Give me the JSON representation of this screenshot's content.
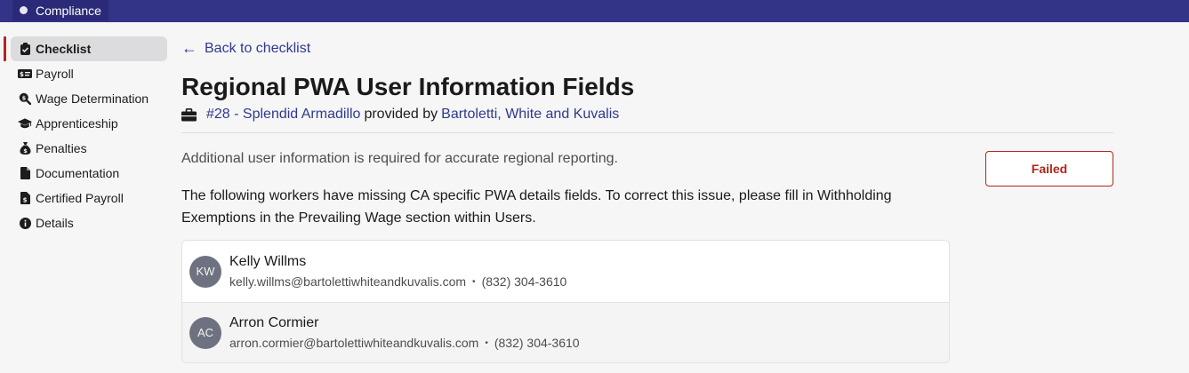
{
  "app": {
    "name": "Compliance"
  },
  "sidebar": {
    "items": [
      {
        "label": "Checklist",
        "icon": "clipboard-check-icon",
        "active": true
      },
      {
        "label": "Payroll",
        "icon": "money-check-icon"
      },
      {
        "label": "Wage Determination",
        "icon": "search-dollar-icon"
      },
      {
        "label": "Apprenticeship",
        "icon": "graduation-cap-icon"
      },
      {
        "label": "Penalties",
        "icon": "money-bag-icon"
      },
      {
        "label": "Documentation",
        "icon": "document-icon"
      },
      {
        "label": "Certified Payroll",
        "icon": "file-certificate-icon"
      },
      {
        "label": "Details",
        "icon": "info-circle-icon"
      }
    ]
  },
  "header": {
    "back_label": "Back to checklist",
    "title": "Regional PWA User Information Fields",
    "project_link": "#28 - Splendid Armadillo",
    "provided_by": "provided by",
    "company_link": "Bartoletti, White and Kuvalis"
  },
  "check": {
    "description": "Additional user information is required for accurate regional reporting.",
    "message": "The following workers have missing CA specific PWA details fields. To correct this issue, please fill in Withholding Exemptions in the Prevailing Wage section within Users.",
    "status": "Failed",
    "status_color": "#b3261e"
  },
  "workers": [
    {
      "initials": "KW",
      "name": "Kelly Willms",
      "email": "kelly.willms@bartolettiwhiteandkuvalis.com",
      "phone": "(832) 304-3610"
    },
    {
      "initials": "AC",
      "name": "Arron Cormier",
      "email": "arron.cormier@bartolettiwhiteandkuvalis.com",
      "phone": "(832) 304-3610"
    }
  ],
  "colors": {
    "topbar": "#333387",
    "link": "#2f3a8c",
    "accent": "#b3261e"
  }
}
